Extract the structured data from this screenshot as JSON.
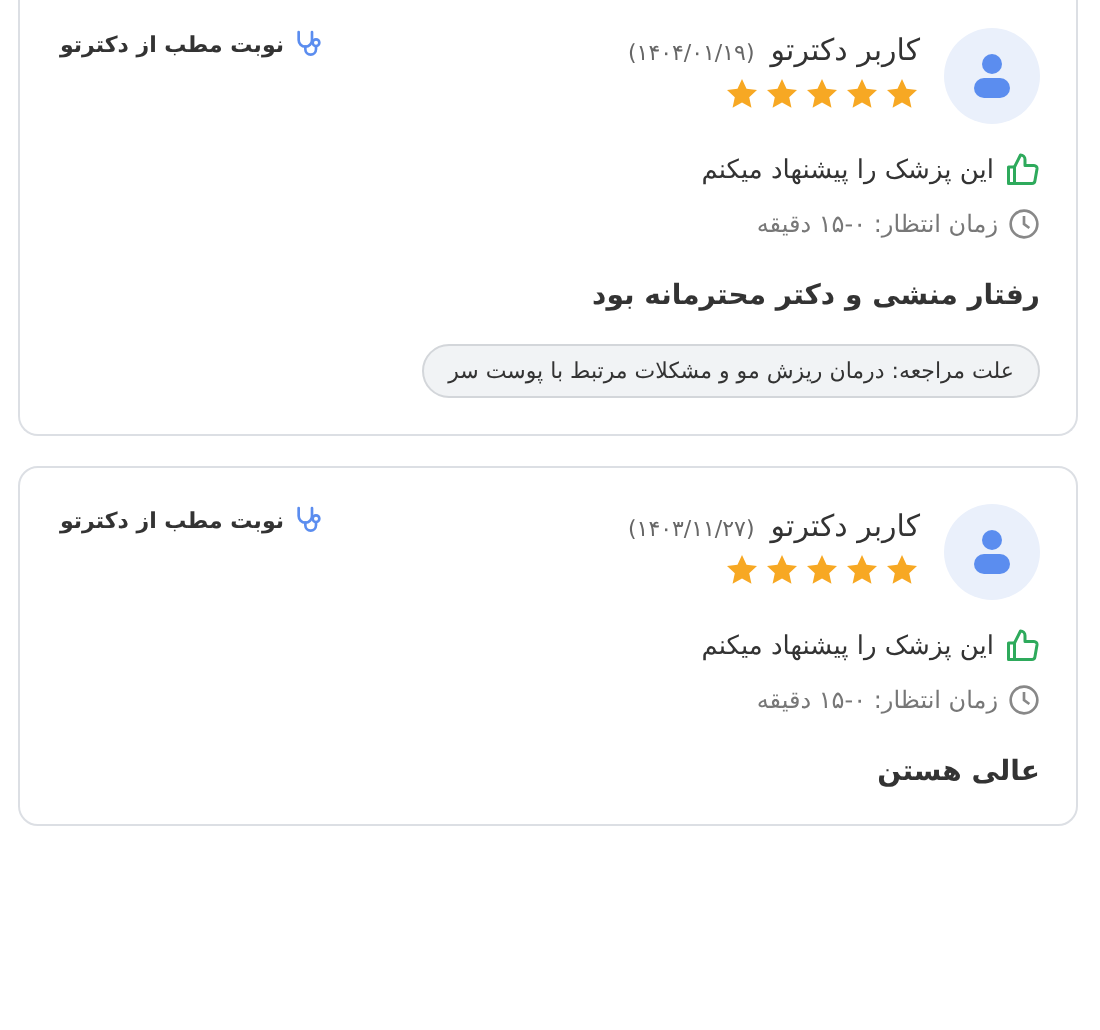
{
  "reviews": [
    {
      "user": "کاربر دکترتو",
      "date": "(۱۴۰۴/۰۱/۱۹)",
      "stars": 5,
      "recommend": "این پزشک را پیشنهاد میکنم",
      "wait_time": "زمان انتظار: ۰-۱۵ دقیقه",
      "comment": "رفتار منشی و دکتر محترمانه بود",
      "reason": "علت مراجعه: درمان ریزش مو و مشکلات مرتبط با پوست سر",
      "source": "نوبت مطب از دکترتو"
    },
    {
      "user": "کاربر دکترتو",
      "date": "(۱۴۰۳/۱۱/۲۷)",
      "stars": 5,
      "recommend": "این پزشک را پیشنهاد میکنم",
      "wait_time": "زمان انتظار: ۰-۱۵ دقیقه",
      "comment": "عالی هستن",
      "source": "نوبت مطب از دکترتو"
    }
  ]
}
